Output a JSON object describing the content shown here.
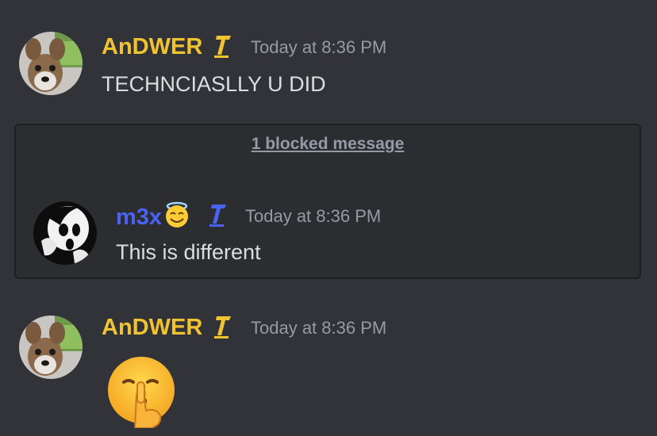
{
  "messages": [
    {
      "author": "AnDWER",
      "author_color": "#f0c431",
      "timestamp": "Today at 8:36 PM",
      "text": "TECHNCIASLLY U DID"
    },
    {
      "author": "AnDWER",
      "author_color": "#f0c431",
      "timestamp": "Today at 8:36 PM",
      "text": ""
    }
  ],
  "blocked": {
    "link_text": "1 blocked message",
    "message": {
      "author": "m3x",
      "author_color": "#4a63f5",
      "author_emoji": "smiling-face-with-halo",
      "timestamp": "Today at 8:36 PM",
      "text": "This is different"
    }
  },
  "colors": {
    "background": "#313338",
    "blocked_background": "#2b2d31",
    "role_icon_yellow": "#f0c431",
    "role_icon_blue": "#4a63f5",
    "timestamp": "#949ba4",
    "text": "#dbdee1"
  },
  "icons": {
    "role_icon": "role-badge-icon",
    "big_emoji": "shushing-face-emoji"
  }
}
